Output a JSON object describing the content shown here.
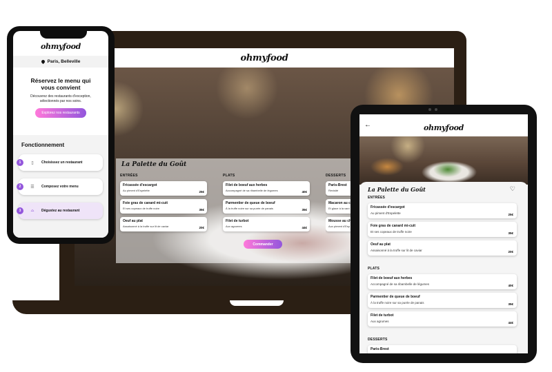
{
  "brand": "ohmyfood",
  "laptop": {
    "restaurant": "La Palette du Goût",
    "cta": "Commander",
    "columns": [
      {
        "title": "ENTRÉES",
        "items": [
          {
            "name": "Fricassée d'escargot",
            "desc": "Au piment d'Espelette",
            "price": "25€"
          },
          {
            "name": "Foie gras de canard mi-cuit",
            "desc": "Et ses copeaux de truffe noire",
            "price": "35€"
          },
          {
            "name": "Oeuf au plat",
            "desc": "Assaisonné à la truffe sur lit de caviar",
            "price": "20€"
          }
        ]
      },
      {
        "title": "PLATS",
        "items": [
          {
            "name": "Filet de boeuf aux herbes",
            "desc": "Accompagné de sa ribambelle de légumes",
            "price": "40€"
          },
          {
            "name": "Parmentier de queue de boeuf",
            "desc": "À la truffe noire sur sa purée de panais",
            "price": "35€"
          },
          {
            "name": "Filet de turbot",
            "desc": "Aux agrumes",
            "price": "44€"
          }
        ]
      },
      {
        "title": "DESSERTS",
        "items": [
          {
            "name": "Paris-Brest",
            "desc": "Revisité",
            "price": ""
          },
          {
            "name": "Macaron au c",
            "desc": "Et glace à la vani",
            "price": ""
          },
          {
            "name": "Mousse au ch",
            "desc": "Aux piment d'Esp",
            "price": ""
          }
        ]
      }
    ]
  },
  "phone": {
    "location": "Paris, Belleville",
    "hero_title": "Réservez le menu qui vous convient",
    "hero_sub": "Découvrez des restaurants d'exception, sélectionnés par nos soins.",
    "cta": "Explorez nos restaurants",
    "how_title": "Fonctionnement",
    "steps": [
      {
        "num": "1",
        "label": "Choisissez un restaurant",
        "icon": "phone-icon"
      },
      {
        "num": "2",
        "label": "Composez votre menu",
        "icon": "list-icon"
      },
      {
        "num": "3",
        "label": "Dégustez au restaurant",
        "icon": "dish-icon"
      }
    ]
  },
  "tablet": {
    "back": "←",
    "restaurant": "La Palette du Goût",
    "heart": "♡",
    "sections": [
      {
        "title": "ENTRÉES",
        "items": [
          {
            "name": "Fricassée d'escargot",
            "desc": "Au piment d'Espelette",
            "price": "25€"
          },
          {
            "name": "Foie gras de canard mi-cuit",
            "desc": "Et ses copeaux de truffe noire",
            "price": "35€"
          },
          {
            "name": "Oeuf au plat",
            "desc": "Assaisonné à la truffe sur lit de caviar",
            "price": "20€"
          }
        ]
      },
      {
        "title": "PLATS",
        "items": [
          {
            "name": "Filet de boeuf aux herbes",
            "desc": "Accompagné de sa ribambelle de légumes",
            "price": "40€"
          },
          {
            "name": "Parmentier de queue de boeuf",
            "desc": "À la truffe noire sur sa purée de panais",
            "price": "35€"
          },
          {
            "name": "Filet de turbot",
            "desc": "Aux agrumes",
            "price": "44€"
          }
        ]
      },
      {
        "title": "DESSERTS",
        "items": [
          {
            "name": "Paris-Brest",
            "desc": "",
            "price": ""
          }
        ]
      }
    ]
  }
}
